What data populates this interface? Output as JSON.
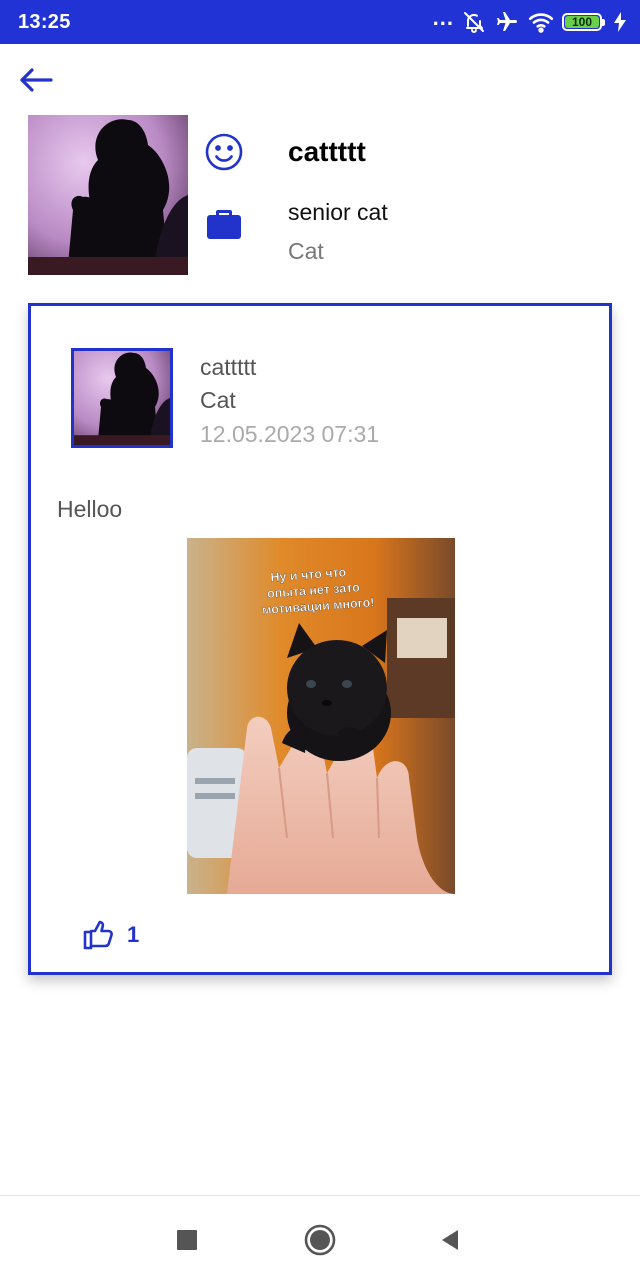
{
  "status_bar": {
    "time": "13:25",
    "dots": "...",
    "battery": "100",
    "icons": [
      "bell-off-icon",
      "airplane-icon",
      "wifi-icon",
      "battery-icon",
      "charging-icon"
    ]
  },
  "header": {
    "back_icon": "arrow-left-icon"
  },
  "profile": {
    "name": "cattttt",
    "position": "senior cat",
    "department": "Cat",
    "name_icon": "smile-icon",
    "position_icon": "briefcase-icon"
  },
  "post": {
    "author": "cattttt",
    "department": "Cat",
    "date": "12.05.2023 07:31",
    "text": "Helloo",
    "image_caption": [
      "Ну и что что",
      "опыта нет зато",
      "мотивации много!"
    ],
    "likes": "1",
    "like_icon": "thumbs-up-icon"
  },
  "colors": {
    "accent": "#2233cc",
    "status_bar": "#2233d6"
  },
  "navbar": {
    "items": [
      "recent-apps-icon",
      "home-icon",
      "back-triangle-icon"
    ]
  }
}
